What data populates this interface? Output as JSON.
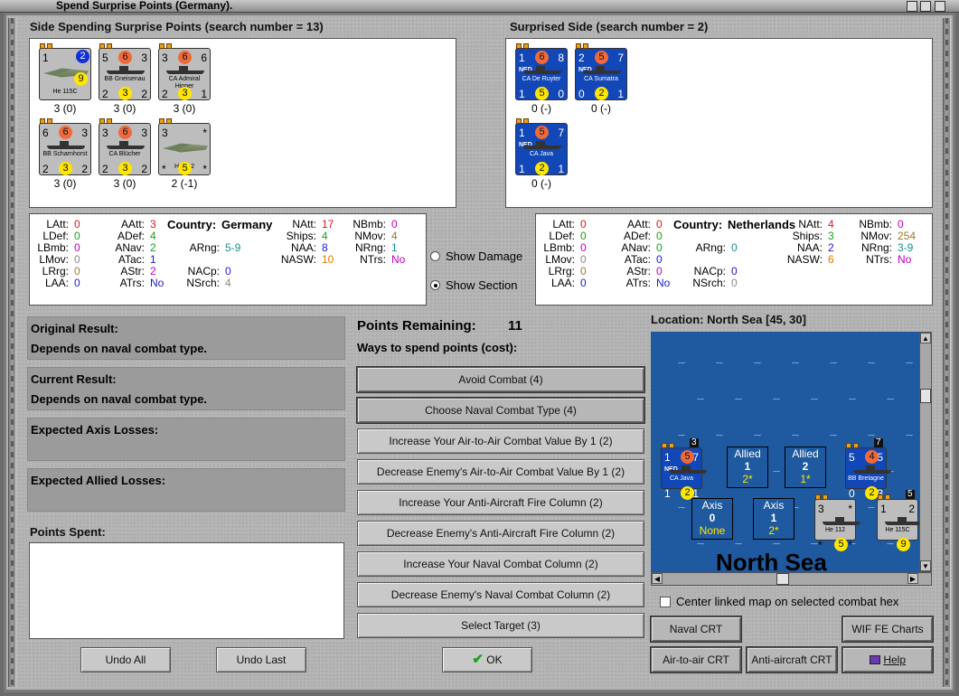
{
  "window": {
    "title": "Spend Surprise Points (Germany)."
  },
  "spending_side": {
    "header": "Side Spending Surprise Points (search number = 13)",
    "units": [
      {
        "name": "He 115C",
        "kind": "plane",
        "tl": "1",
        "tr_circle": "2",
        "yellow": "9",
        "caption": "3 (0)"
      },
      {
        "name": "BB Gneisenau",
        "kind": "ship",
        "tl": "5",
        "top": "6",
        "tr": "3",
        "bl": "2",
        "yellow": "3",
        "br": "2",
        "caption": "3 (0)"
      },
      {
        "name": "CA Admiral Hipper",
        "kind": "ship",
        "tl": "3",
        "top": "6",
        "tr": "6",
        "bl": "2",
        "yellow": "3",
        "br": "1",
        "caption": "3 (0)"
      },
      {
        "name": "BB Scharnhorst",
        "kind": "ship",
        "tl": "6",
        "top": "6",
        "tr": "3",
        "bl": "2",
        "yellow": "3",
        "br": "2",
        "caption": "3 (0)"
      },
      {
        "name": "CA Blücher",
        "kind": "ship",
        "tl": "3",
        "top": "6",
        "tr": "3",
        "bl": "2",
        "yellow": "3",
        "br": "2",
        "caption": "3 (0)"
      },
      {
        "name": "He 112",
        "kind": "plane",
        "tl": "3",
        "tr": "*",
        "bl": "*",
        "yellow": "5",
        "br": "*",
        "caption": "2 (-1)"
      }
    ]
  },
  "surprised_side": {
    "header": "Surprised Side (search number = 2)",
    "units": [
      {
        "name": "CA De Ruyter",
        "nation": "NED",
        "tl": "1",
        "top": "6",
        "tr": "8",
        "bl": "1",
        "yellow": "5",
        "br": "0",
        "caption": "0 (-)"
      },
      {
        "name": "CA Sumatra",
        "nation": "NED",
        "tl": "2",
        "top": "5",
        "tr": "7",
        "bl": "0",
        "yellow": "2",
        "br": "1",
        "caption": "0 (-)"
      },
      {
        "name": "CA Java",
        "nation": "NED",
        "tl": "1",
        "top": "5",
        "tr": "7",
        "bl": "1",
        "yellow": "2",
        "br": "1",
        "caption": "0 (-)"
      }
    ]
  },
  "stats_left": {
    "country_label": "Country:",
    "country": "Germany",
    "rows": [
      [
        "LAtt:",
        "0",
        "AAtt:",
        "3",
        "",
        "",
        "NAtt:",
        "17",
        "NBmb:",
        "0"
      ],
      [
        "LDef:",
        "0",
        "ADef:",
        "4",
        "",
        "",
        "Ships:",
        "4",
        "NMov:",
        "4"
      ],
      [
        "LBmb:",
        "0",
        "ANav:",
        "2",
        "ARng:",
        "5-9",
        "NAA:",
        "8",
        "NRng:",
        "1"
      ],
      [
        "LMov:",
        "0",
        "ATac:",
        "1",
        "",
        "",
        "NASW:",
        "10",
        "NTrs:",
        "No"
      ],
      [
        "LRrg:",
        "0",
        "AStr:",
        "2",
        "NACp:",
        "0",
        "",
        "",
        "",
        ""
      ],
      [
        "LAA:",
        "0",
        "ATrs:",
        "No",
        "NSrch:",
        "4",
        "",
        "",
        "",
        ""
      ]
    ]
  },
  "stats_right": {
    "country_label": "Country:",
    "country": "Netherlands",
    "rows": [
      [
        "LAtt:",
        "0",
        "AAtt:",
        "0",
        "",
        "",
        "NAtt:",
        "4",
        "NBmb:",
        "0"
      ],
      [
        "LDef:",
        "0",
        "ADef:",
        "0",
        "",
        "",
        "Ships:",
        "3",
        "NMov:",
        "254"
      ],
      [
        "LBmb:",
        "0",
        "ANav:",
        "0",
        "ARng:",
        "0",
        "NAA:",
        "2",
        "NRng:",
        "3-9"
      ],
      [
        "LMov:",
        "0",
        "ATac:",
        "0",
        "",
        "",
        "NASW:",
        "6",
        "NTrs:",
        "No"
      ],
      [
        "LRrg:",
        "0",
        "AStr:",
        "0",
        "NACp:",
        "0",
        "",
        "",
        "",
        ""
      ],
      [
        "LAA:",
        "0",
        "ATrs:",
        "No",
        "NSrch:",
        "0",
        "",
        "",
        "",
        ""
      ]
    ]
  },
  "options": {
    "show_damage": "Show Damage",
    "show_section": "Show Section"
  },
  "results": {
    "original_title": "Original Result:",
    "original_value": "Depends on naval combat type.",
    "current_title": "Current Result:",
    "current_value": "Depends on naval combat type.",
    "axis_losses_title": "Expected Axis Losses:",
    "allied_losses_title": "Expected Allied Losses:",
    "points_spent_title": "Points Spent:"
  },
  "spend": {
    "remaining_label": "Points Remaining:",
    "remaining_value": "11",
    "ways_label": "Ways to spend points (cost):",
    "options": [
      "Avoid Combat (4)",
      "Choose Naval Combat Type (4)",
      "Increase Your Air-to-Air Combat Value By 1 (2)",
      "Decrease Enemy's Air-to-Air Combat Value By 1 (2)",
      "Increase Your Anti-Aircraft Fire Column (2)",
      "Decrease Enemy's Anti-Aircraft Fire Column (2)",
      "Increase Your Naval Combat Column (2)",
      "Decrease Enemy's Naval Combat Column (2)",
      "Select Target (3)"
    ]
  },
  "map": {
    "location": "Location: North Sea [45, 30]",
    "sea_name": "North Sea",
    "allied_boxes": [
      {
        "label": "Allied",
        "num": "1",
        "sub": "2*"
      },
      {
        "label": "Allied",
        "num": "2",
        "sub": "1*"
      }
    ],
    "axis_boxes": [
      {
        "label": "Axis",
        "num": "0",
        "sub": "None"
      },
      {
        "label": "Axis",
        "num": "1",
        "sub": "2*"
      }
    ],
    "map_units": [
      {
        "name": "CA Java",
        "nation": "NED",
        "tl": "1",
        "top": "5",
        "tr": "7",
        "bl": "1",
        "yellow": "2",
        "br": "1",
        "stack": "3"
      },
      {
        "name": "BB Bretagne",
        "tl": "5",
        "top": "4",
        "tr": "5",
        "bl": "0",
        "yellow": "2",
        "br": "3",
        "stack": "7"
      },
      {
        "name": "He 112",
        "tl": "3",
        "tr": "*",
        "bl": "*",
        "yellow": "5",
        "br": "*"
      },
      {
        "name": "He 115C",
        "tl": "1",
        "tr": "2",
        "yellow": "9",
        "stack": "5"
      }
    ],
    "center_linked": "Center linked map on selected combat hex"
  },
  "buttons": {
    "naval_crt": "Naval CRT",
    "wif_fe_charts": "WIF FE Charts",
    "air_to_air_crt": "Air-to-air CRT",
    "anti_aircraft_crt": "Anti-aircraft CRT",
    "help": "Help",
    "undo_all": "Undo All",
    "undo_last": "Undo Last",
    "ok": "OK"
  },
  "colors": {
    "accent_blue": "#1247b8",
    "sea": "#1f5aa0",
    "red_circle": "#ef6a3a",
    "yellow_circle": "#ffe600"
  }
}
